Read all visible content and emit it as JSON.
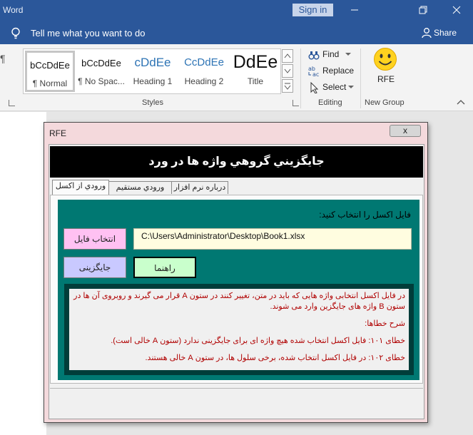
{
  "window": {
    "app_title": "Word",
    "sign_in": "Sign in",
    "minimize_icon": "minimize-icon",
    "restore_icon": "restore-icon",
    "close_icon": "close-icon"
  },
  "tellme": {
    "text": "Tell me what you want to do",
    "share_label": "Share"
  },
  "ribbon": {
    "styles_gallery": [
      {
        "sample": "bCcDdEe",
        "name": "¶ Normal",
        "selected": true
      },
      {
        "sample": "bCcDdEe",
        "name": "¶ No Spac..."
      },
      {
        "sample": "cDdEe",
        "name": "Heading 1"
      },
      {
        "sample": "CcDdEe",
        "name": "Heading 2"
      },
      {
        "sample": "DdEe",
        "name": "Title"
      }
    ],
    "styles_label": "Styles",
    "editing": {
      "find": "Find",
      "replace": "Replace",
      "select": "Select"
    },
    "editing_label": "Editing",
    "rfe_button": "RFE",
    "new_group_label": "New Group"
  },
  "dialog": {
    "title": "RFE",
    "close_glyph": "x",
    "banner": "جايگزيني گروهي واژه ها در ورد",
    "tabs": [
      "ورودي از اكسل",
      "ورودي مستقيم",
      "درباره نرم افزار"
    ],
    "prompt": "فایل اکسل را انتخاب کنید:",
    "file_path": "C:\\Users\\Administrator\\Desktop\\Book1.xlsx",
    "btn_select_file": "انتخاب فایل",
    "btn_replace": "جایگزینی",
    "btn_help": "راهنما",
    "help": {
      "intro": "در فایل اکسل انتخابی واژه هایی که باید در متن، تغییر کنند در ستون A قرار می گیرند و روبروی آن ها در ستون B واژه های جایگزین وارد می شوند.",
      "errors_title": "شرح خطاها:",
      "error_101": "خطای ۱۰۱: فایل اکسل انتخاب شده هیچ واژه ای برای جایگزینی ندارد (ستون A خالی است).",
      "error_102": "خطای ۱۰۲: در فایل اکسل انتخاب شده، برخی سلول ها، در ستون A خالی هستند."
    }
  },
  "colors": {
    "word_blue": "#2b579a",
    "teal_panel": "#007872",
    "help_text_red": "#b00000"
  }
}
